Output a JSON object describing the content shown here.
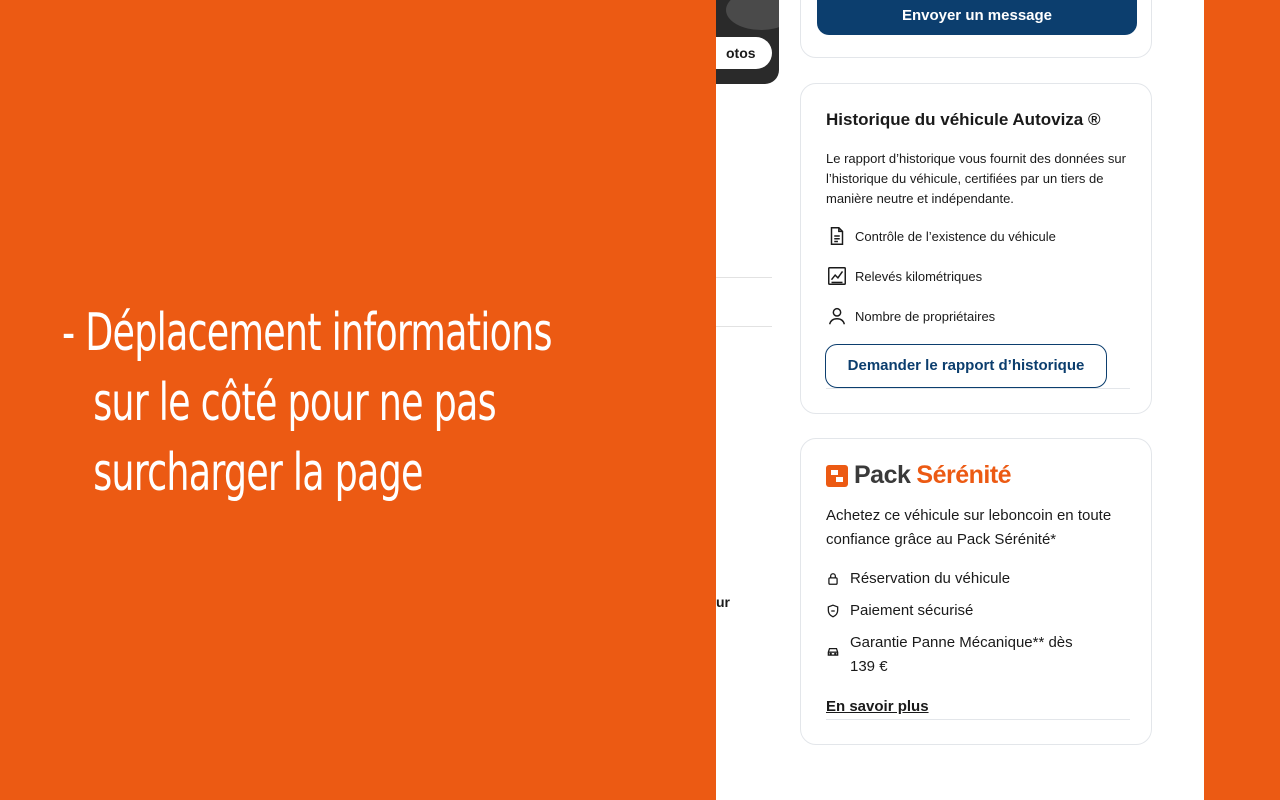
{
  "caption": {
    "line1": "- Déplacement informations",
    "line2": "sur le côté pour ne pas",
    "line3": "surcharger la page"
  },
  "page": {
    "photos_pill": "otos",
    "cut_text": "ur",
    "send_button": "Envoyer un message",
    "history": {
      "title": "Historique du véhicule Autoviza ®",
      "description": "Le rapport d’historique vous fournit des données sur l’historique du véhicule, certifiées par un tiers de manière neutre et indépendante.",
      "features": [
        {
          "icon": "document-icon",
          "label": "Contrôle de l’existence du véhicule"
        },
        {
          "icon": "chart-icon",
          "label": "Relevés kilométriques"
        },
        {
          "icon": "person-icon",
          "label": "Nombre de propriétaires"
        }
      ],
      "button": "Demander le rapport d’historique"
    },
    "pack": {
      "logo_word1": "Pack",
      "logo_word2": "Sérénité",
      "description": "Achetez ce véhicule sur leboncoin en toute confiance grâce au Pack Sérénité*",
      "features": [
        {
          "icon": "lock-icon",
          "label": "Réservation du véhicule"
        },
        {
          "icon": "shield-icon",
          "label": "Paiement sécurisé"
        },
        {
          "icon": "car-icon",
          "label": "Garantie Panne Mécanique** dès 139 €"
        }
      ],
      "link": "En savoir plus"
    }
  },
  "colors": {
    "orange": "#ec5a13",
    "navy": "#0c3e6e"
  }
}
